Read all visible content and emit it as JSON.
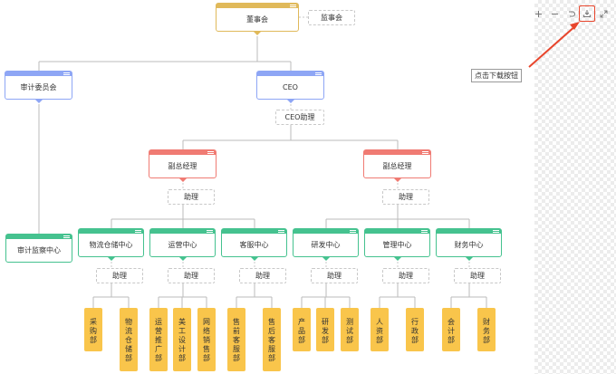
{
  "colors": {
    "gold": "#e0b95a",
    "blue": "#8ea6f5",
    "red": "#f07b73",
    "green": "#45c28f",
    "dept": "#f9c54b",
    "line": "#bbbbbb",
    "accent": "#e8452c"
  },
  "toolbar": {
    "zoom_in_icon": "plus-icon",
    "zoom_out_icon": "minus-icon",
    "reset_icon": "undo-icon",
    "download_icon": "download-icon",
    "fullscreen_icon": "fullscreen-icon"
  },
  "callout": "点击下载按钮",
  "org": {
    "board": "董事会",
    "supervisory": "监事会",
    "audit_committee": "审计委员会",
    "ceo": "CEO",
    "ceo_assistant": "CEO助理",
    "audit_center": "审计监察中心",
    "vps": [
      {
        "title": "副总经理",
        "assistant": "助理"
      },
      {
        "title": "副总经理",
        "assistant": "助理"
      }
    ],
    "centers": [
      {
        "title": "物流仓储中心",
        "assistant": "助理",
        "depts": [
          "采购部",
          "物流仓储部"
        ]
      },
      {
        "title": "运营中心",
        "assistant": "助理",
        "depts": [
          "运营推广部",
          "美工设计部",
          "网络销售部"
        ]
      },
      {
        "title": "客服中心",
        "assistant": "助理",
        "depts": [
          "售前客服部",
          "售后客服部"
        ]
      },
      {
        "title": "研发中心",
        "assistant": "助理",
        "depts": [
          "产品部",
          "研发部",
          "测试部"
        ]
      },
      {
        "title": "管理中心",
        "assistant": "助理",
        "depts": [
          "人资部",
          "行政部"
        ]
      },
      {
        "title": "财务中心",
        "assistant": "助理",
        "depts": [
          "会计部",
          "财务部"
        ]
      }
    ]
  }
}
